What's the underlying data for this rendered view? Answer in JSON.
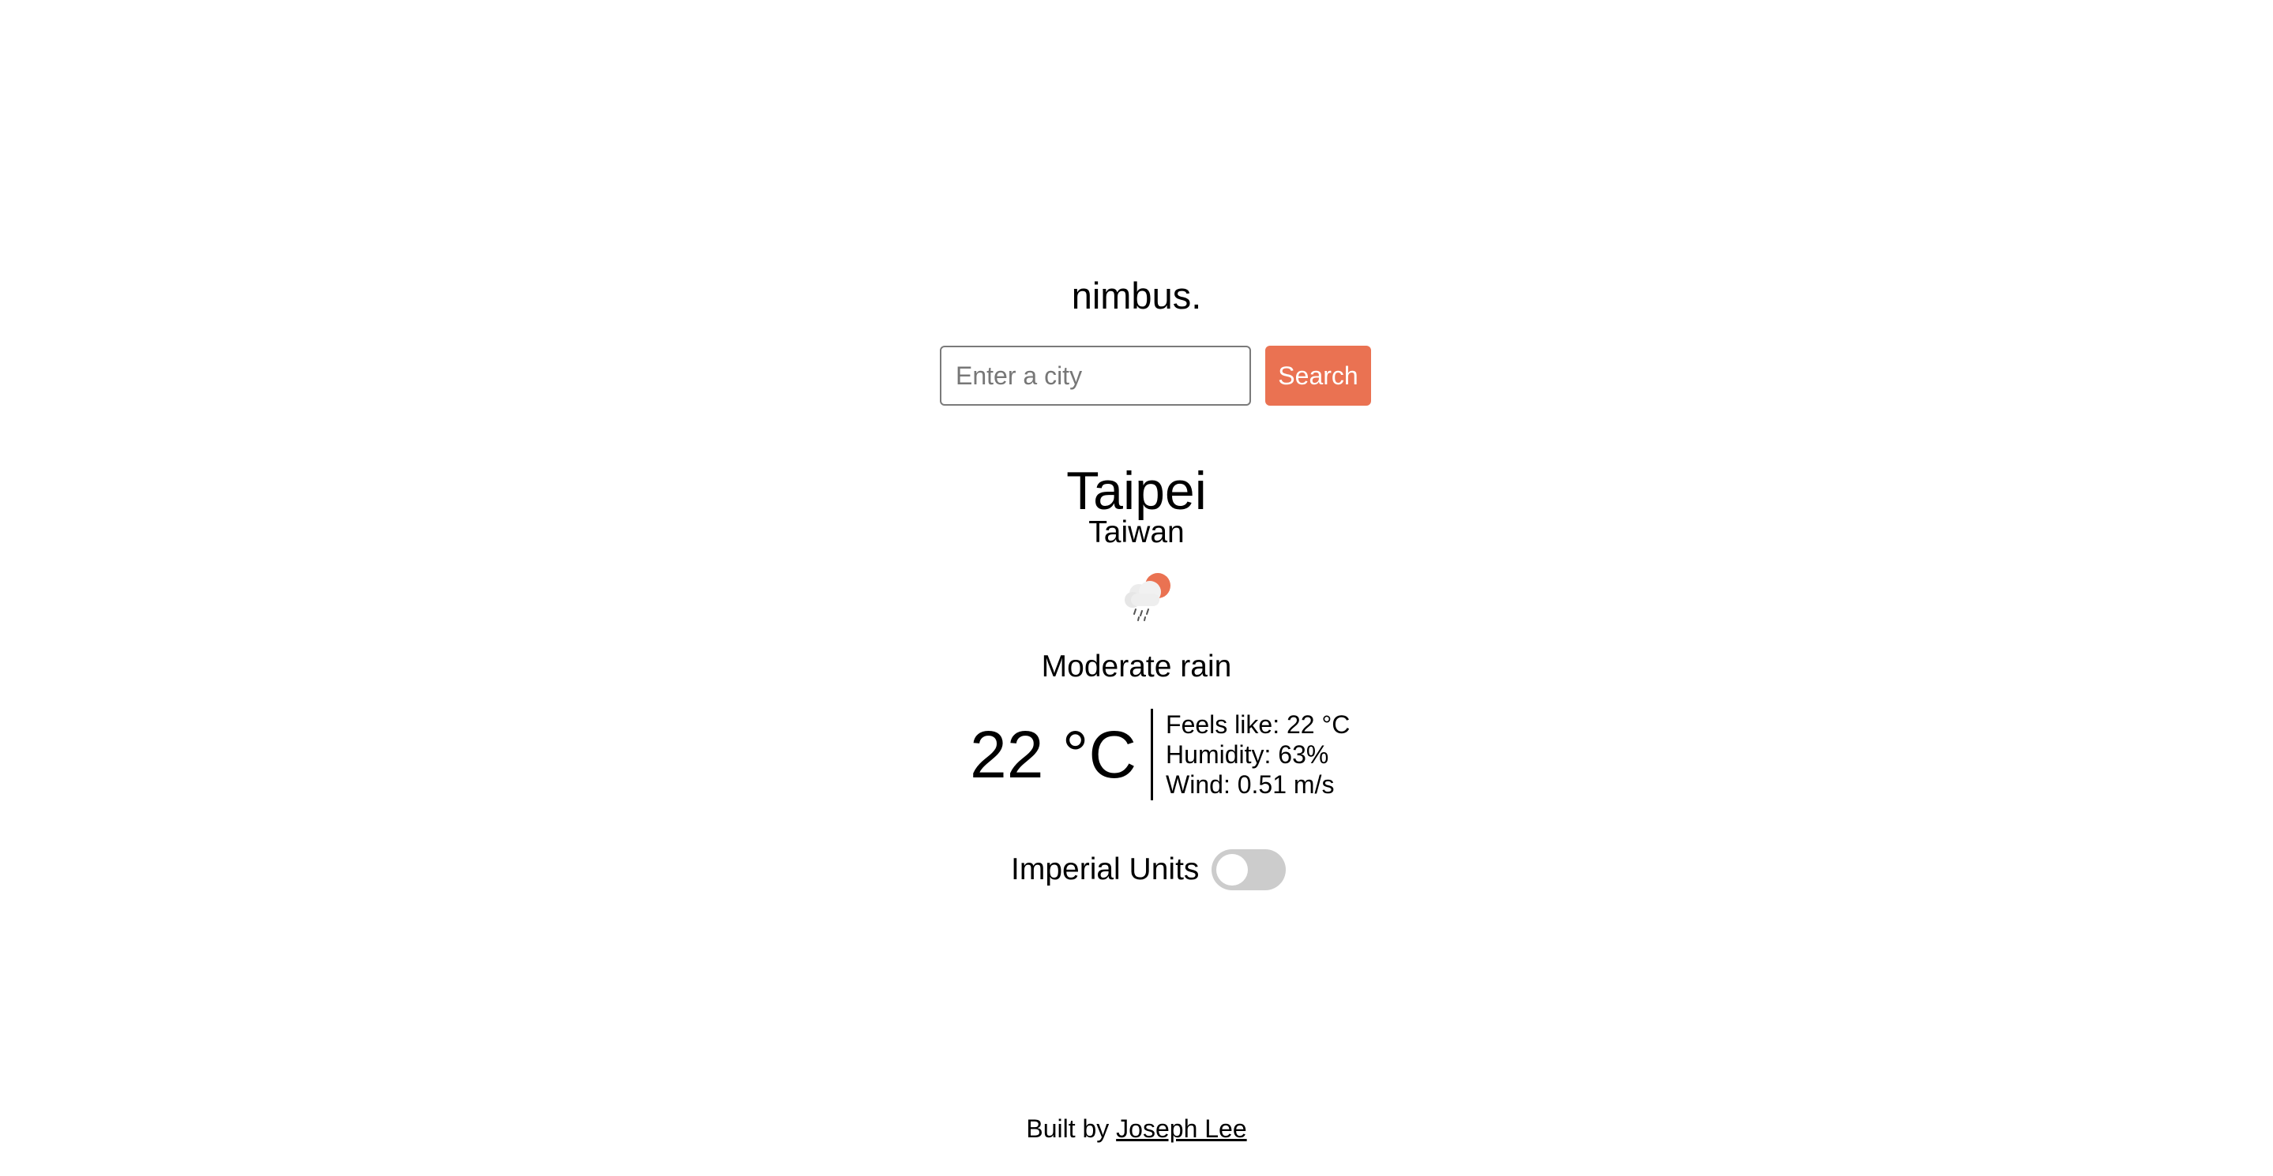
{
  "app": {
    "title": "nimbus."
  },
  "search": {
    "placeholder": "Enter a city",
    "value": "",
    "button_label": "Search"
  },
  "location": {
    "city": "Taipei",
    "country": "Taiwan"
  },
  "weather": {
    "icon": "cloud-rain-sun-icon",
    "condition": "Moderate rain",
    "temperature": "22 °C",
    "feels_like": "Feels like: 22 °C",
    "humidity": "Humidity: 63%",
    "wind": "Wind: 0.51 m/s"
  },
  "units": {
    "label": "Imperial Units",
    "enabled": false
  },
  "footer": {
    "prefix": "Built by",
    "author_link": "Joseph Lee"
  },
  "colors": {
    "accent": "#ea7252",
    "toggle_off": "#cccccc",
    "background": "#ffffff",
    "text": "#000000"
  }
}
